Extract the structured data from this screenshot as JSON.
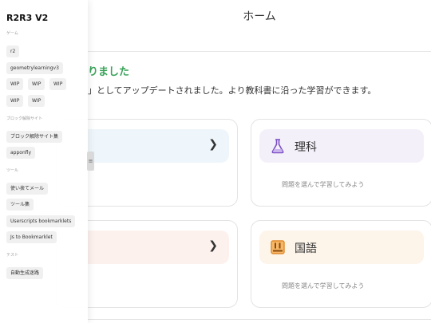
{
  "header": {
    "title": "ホーム"
  },
  "banner": {
    "title": "りました",
    "text": "」としてアップデートされました。より教科書に沿った学習ができます。"
  },
  "cards": [
    {
      "title": "",
      "subtitle": "",
      "chevron_icon": "chevron-right-icon",
      "head_color": "#eef6fb"
    },
    {
      "title": "理科",
      "subtitle": "問題を選んで学習してみよう",
      "icon": "flask-icon",
      "head_color": "#f4f0fa"
    },
    {
      "title": "",
      "subtitle": "",
      "chevron_icon": "chevron-right-icon",
      "head_color": "#fdf1ed"
    },
    {
      "title": "国語",
      "subtitle": "問題を選んで学習してみよう",
      "icon": "book-icon",
      "head_color": "#fdf4ea"
    }
  ],
  "sidebar": {
    "title": "R2R3 V2",
    "sections": [
      {
        "label": "ゲーム",
        "items": [
          "r2",
          "geometrylearningv3",
          "WIP",
          "WIP",
          "WIP",
          "WIP",
          "WIP"
        ]
      },
      {
        "label": "ブロック解除サイト",
        "items": [
          "ブロック解除サイト集",
          "apponfly"
        ]
      },
      {
        "label": "ツール",
        "items": [
          "使い捨てメール",
          "ツール集",
          "Userscripts bookmarklets",
          "Js to Bookmarklet"
        ]
      },
      {
        "label": "テスト",
        "items": [
          "自動生成迷路"
        ]
      }
    ],
    "handle_label": "≡"
  },
  "colors": {
    "accent_green": "#3aa35a",
    "flask_purple": "#7b4fc4",
    "book_orange": "#e08a2c"
  }
}
